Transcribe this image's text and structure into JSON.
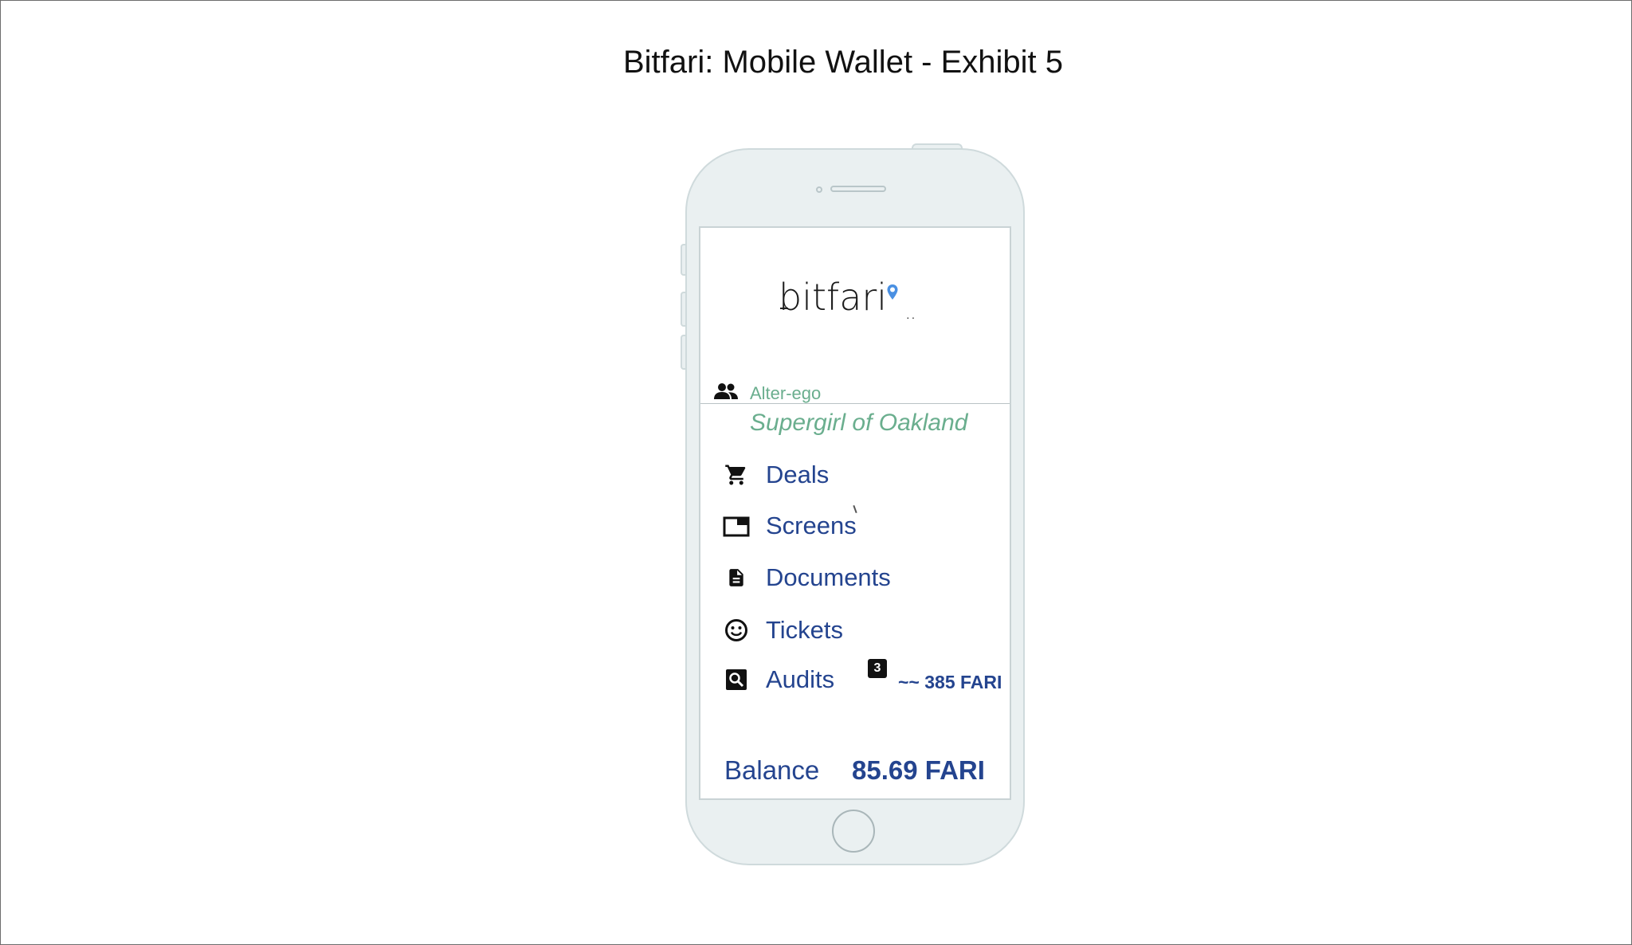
{
  "exhibit": {
    "title": "Bitfari: Mobile Wallet - Exhibit 5"
  },
  "app": {
    "logo_text": "bitfari",
    "alter_ego": {
      "label": "Alter-ego",
      "value": "Supergirl of Oakland"
    },
    "menu": [
      {
        "label": "Deals",
        "icon": "cart-icon"
      },
      {
        "label": "Screens",
        "icon": "screen-icon"
      },
      {
        "label": "Documents",
        "icon": "document-icon"
      },
      {
        "label": "Tickets",
        "icon": "smiley-icon"
      },
      {
        "label": "Audits",
        "icon": "search-icon",
        "badge": "3",
        "amount": "~~ 385 FARI"
      }
    ],
    "balance": {
      "label": "Balance",
      "value": "85.69 FARI"
    }
  },
  "colors": {
    "link_blue": "#24448f",
    "alter_green": "#6aae8e",
    "phone_body": "#eaf0f1",
    "pin_blue": "#4a90e2"
  }
}
